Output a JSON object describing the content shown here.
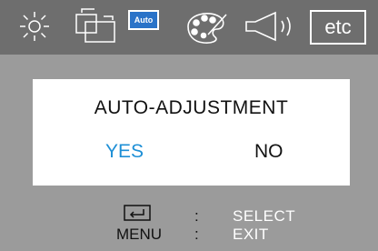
{
  "menu_icons": [
    {
      "name": "brightness",
      "icon": "sun-icon"
    },
    {
      "name": "position",
      "icon": "position-icon"
    },
    {
      "name": "auto",
      "icon": "auto-icon",
      "label": "Auto"
    },
    {
      "name": "color",
      "icon": "palette-icon"
    },
    {
      "name": "audio",
      "icon": "speaker-icon"
    },
    {
      "name": "etc",
      "icon": "etc-icon",
      "label": "etc"
    }
  ],
  "dialog": {
    "title": "AUTO-ADJUSTMENT",
    "yes_label": "YES",
    "no_label": "NO",
    "selected": "YES"
  },
  "help": {
    "enter_sep": ":",
    "enter_action": "SELECT",
    "menu_key": "MENU",
    "menu_sep": ":",
    "menu_action": "EXIT"
  },
  "colors": {
    "topbar": "#6e6e6e",
    "background": "#9b9b9b",
    "selected_option": "#1d8fd6",
    "auto_highlight": "#2a73c8"
  }
}
